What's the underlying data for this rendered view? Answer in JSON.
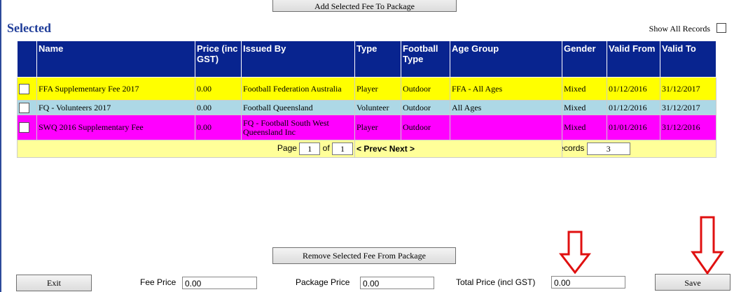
{
  "buttons": {
    "add": "Add Selected Fee To Package",
    "remove": "Remove Selected Fee From Package",
    "exit": "Exit",
    "save": "Save"
  },
  "section_title": "Selected",
  "show_all_label": "Show All Records",
  "columns": [
    "Name",
    "Price (inc GST)",
    "Issued By",
    "Type",
    "Football Type",
    "Age Group",
    "Gender",
    "Valid From",
    "Valid To"
  ],
  "rows": [
    {
      "name": "FFA Supplementary Fee 2017",
      "price": "0.00",
      "issued_by": "Football Federation Australia",
      "type": "Player",
      "football_type": "Outdoor",
      "age_group": "FFA - All Ages",
      "gender": "Mixed",
      "valid_from": "01/12/2016",
      "valid_to": "31/12/2017",
      "color": "#ffff00"
    },
    {
      "name": "FQ - Volunteers 2017",
      "price": "0.00",
      "issued_by": "Football Queensland",
      "type": "Volunteer",
      "football_type": "Outdoor",
      "age_group": "All Ages",
      "gender": "Mixed",
      "valid_from": "01/12/2016",
      "valid_to": "31/12/2017",
      "color": "#add8e6"
    },
    {
      "name": "SWQ 2016 Supplementary Fee",
      "price": "0.00",
      "issued_by": "FQ - Football South West Queensland Inc",
      "type": "Player",
      "football_type": "Outdoor",
      "age_group": "",
      "gender": "Mixed",
      "valid_from": "01/01/2016",
      "valid_to": "31/12/2016",
      "color": "#ff00ff"
    }
  ],
  "pager": {
    "page_label": "Page",
    "page_value": "1",
    "of_label": "of",
    "of_value": "1",
    "prev": "< Prev",
    "next": "< Next >",
    "total_label": "Total Records",
    "total_value": "3"
  },
  "footer": {
    "fee_price_label": "Fee Price",
    "fee_price_value": "0.00",
    "package_price_label": "Package Price",
    "package_price_value": "0.00",
    "total_price_label": "Total Price (incl GST)",
    "total_price_value": "0.00"
  }
}
